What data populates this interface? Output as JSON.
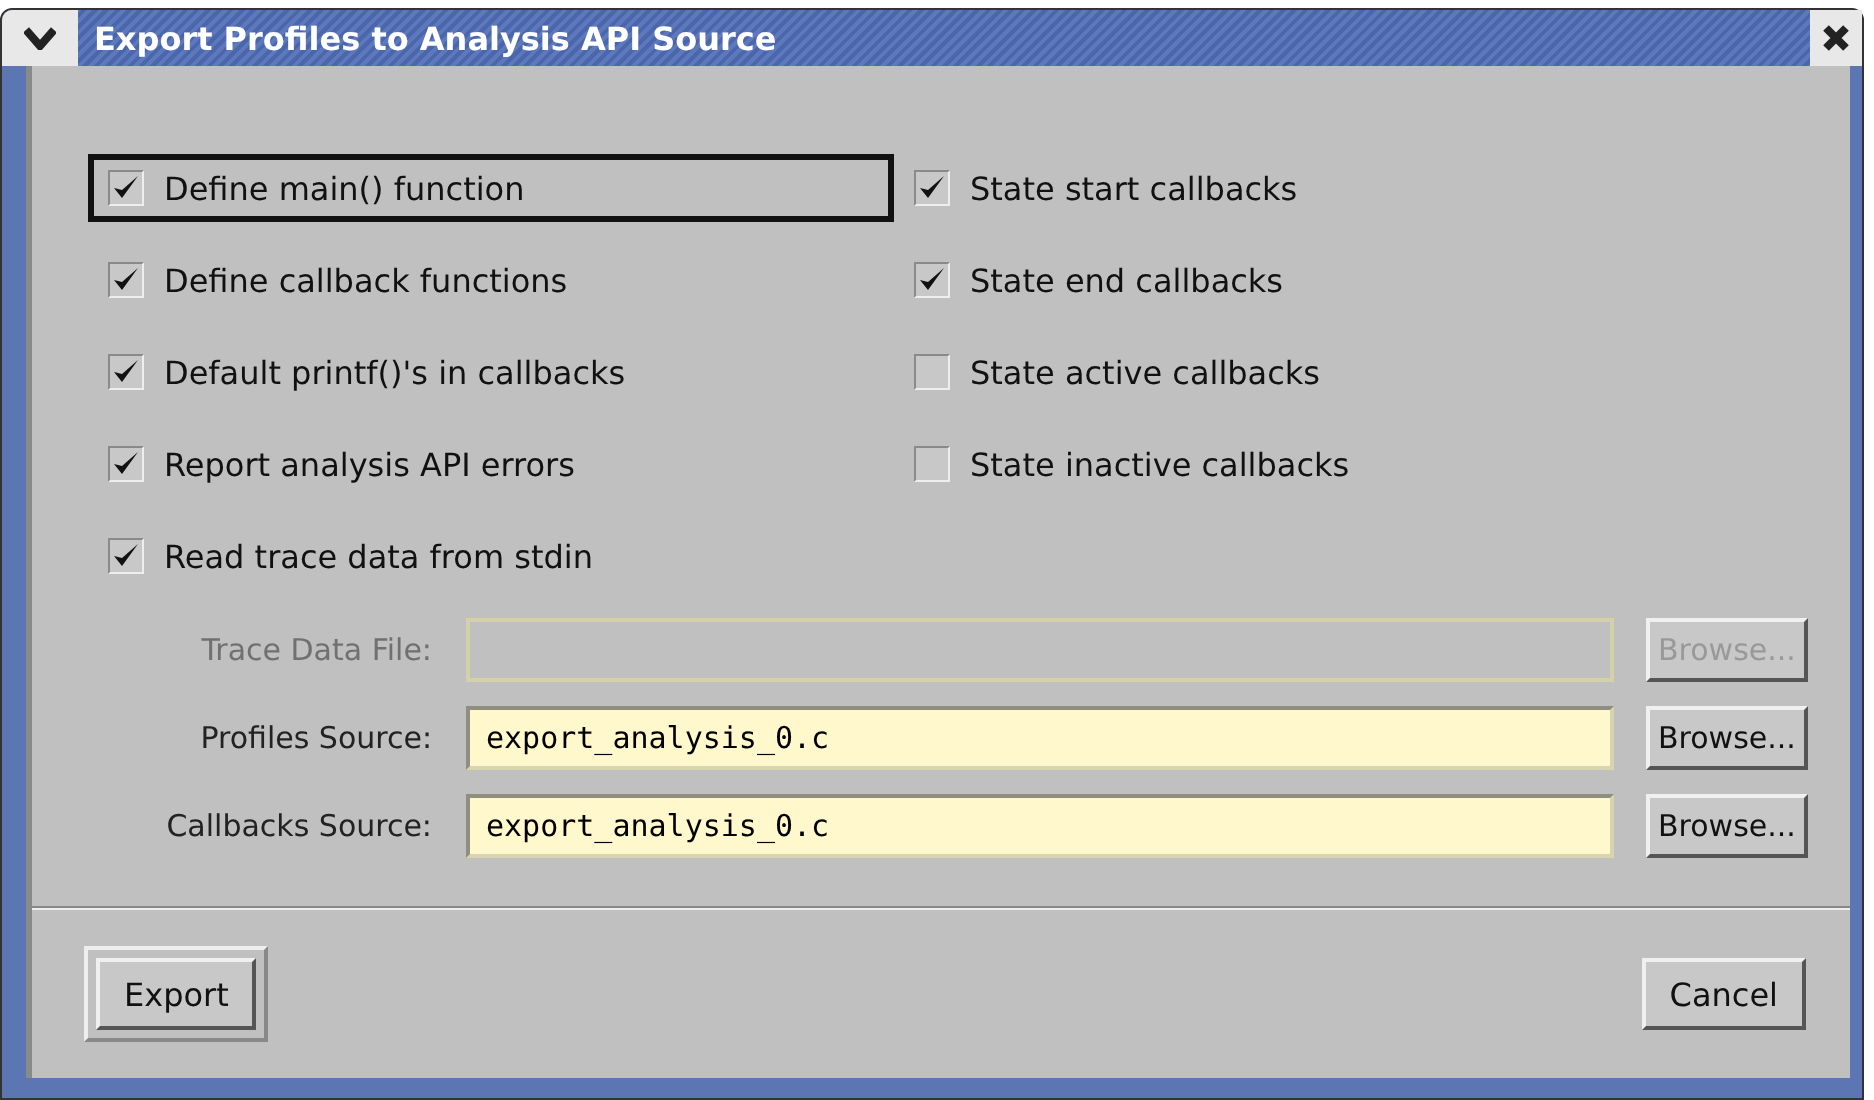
{
  "window": {
    "title": "Export Profiles to Analysis API Source"
  },
  "options_left": [
    {
      "label": "Define main() function",
      "checked": true,
      "focused": true
    },
    {
      "label": "Define callback functions",
      "checked": true,
      "focused": false
    },
    {
      "label": "Default printf()'s in callbacks",
      "checked": true,
      "focused": false
    },
    {
      "label": "Report analysis API errors",
      "checked": true,
      "focused": false
    },
    {
      "label": "Read trace data from stdin",
      "checked": true,
      "focused": false
    }
  ],
  "options_right": [
    {
      "label": "State start callbacks",
      "checked": true,
      "focused": false
    },
    {
      "label": "State end callbacks",
      "checked": true,
      "focused": false
    },
    {
      "label": "State active callbacks",
      "checked": false,
      "focused": false
    },
    {
      "label": "State inactive callbacks",
      "checked": false,
      "focused": false
    }
  ],
  "files": [
    {
      "label": "Trace Data File:",
      "disabled": true,
      "button": "Browse..."
    },
    {
      "label": "Profiles Source:",
      "value": "export_analysis_0.c",
      "disabled": false,
      "button": "Browse..."
    },
    {
      "label": "Callbacks Source:",
      "value": "export_analysis_0.c",
      "disabled": false,
      "button": "Browse..."
    }
  ],
  "buttons": [
    {
      "label": "Export",
      "default": true
    },
    {
      "label": "Cancel",
      "default": false
    }
  ]
}
